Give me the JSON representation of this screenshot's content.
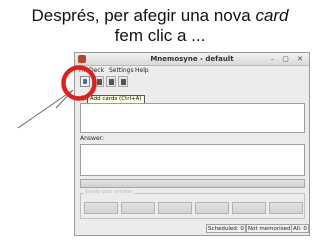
{
  "slide": {
    "caption_line1_prefix": "Després, per afegir una nova ",
    "caption_line1_em": "card",
    "caption_line2": "fem clic a ..."
  },
  "window": {
    "title": "Mnemosyne - default",
    "controls": "– ▢ ✕"
  },
  "menubar": {
    "items": [
      "File",
      "Deck",
      "Settings",
      "Help"
    ]
  },
  "toolbar": {
    "tooltip": "Add cards (Ctrl+A)"
  },
  "question": {
    "label": "Qu"
  },
  "answer": {
    "label": "Answer:"
  },
  "grading": {
    "legend": "Grade your answer"
  },
  "statusbar": {
    "scheduled": "Scheduled: 0",
    "not_memorised": "Not memorised: 0",
    "all": "All: 0"
  },
  "colors": {
    "highlight_circle": "#e0201c",
    "arrow": "#6a6a6a"
  }
}
